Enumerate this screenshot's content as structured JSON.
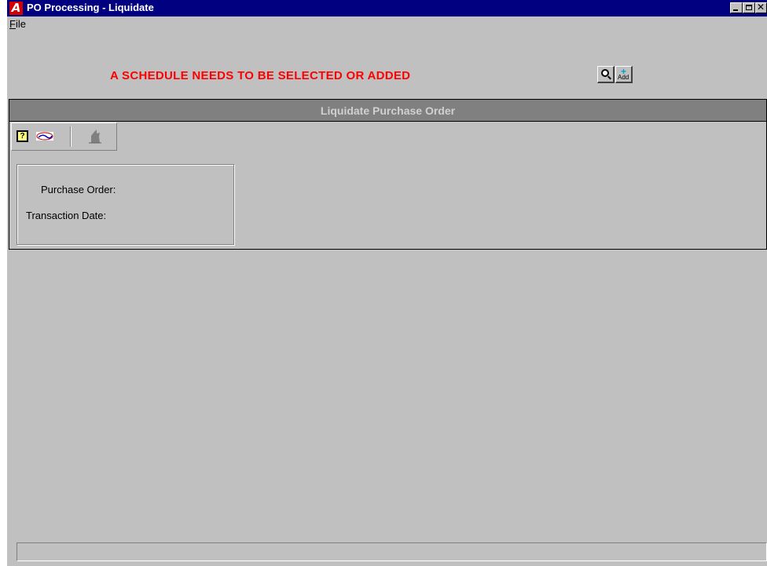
{
  "window": {
    "title": "PO Processing - Liquidate",
    "app_icon_letter": "A",
    "controls": [
      "minimize-icon",
      "maximize-icon",
      "close-icon"
    ]
  },
  "menu": {
    "file_label_accel": "F",
    "file_label_rest": "ile"
  },
  "message": {
    "text": "A SCHEDULE NEEDS TO BE SELECTED OR ADDED",
    "color": "#ff0000"
  },
  "top_buttons": {
    "search_icon": "magnifier-icon",
    "add_label": "Add"
  },
  "panel": {
    "title": "Liquidate Purchase Order",
    "toolbar": {
      "help_glyph": "?",
      "icons": [
        "help-icon",
        "logo-icon",
        "exit-icon"
      ]
    },
    "form": {
      "purchase_order_label": "Purchase Order:",
      "transaction_date_label": "Transaction Date:"
    }
  },
  "colors": {
    "titlebar": "#000080",
    "window_bg": "#c0c0c0",
    "panel_header": "#808080"
  }
}
